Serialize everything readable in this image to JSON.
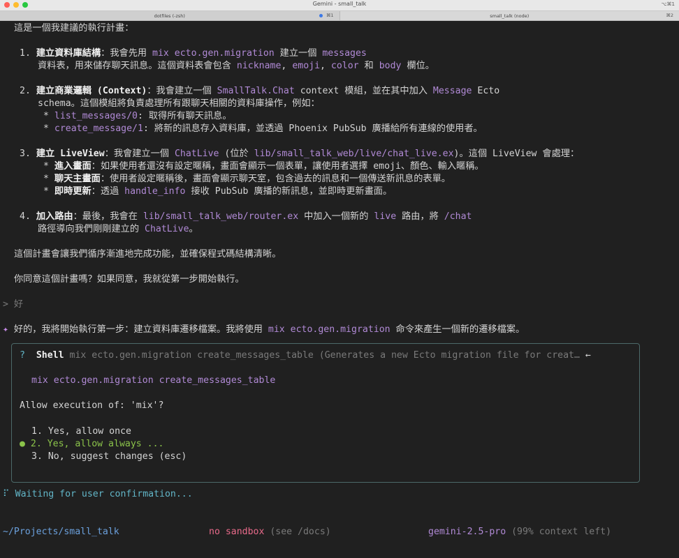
{
  "window": {
    "title": "Gemini - small_talk",
    "shortcut": "⌥⌘1"
  },
  "tabs": [
    {
      "label": "dotfiles (-zsh)",
      "kbd": "⌘1"
    },
    {
      "label": "small_talk (node)",
      "kbd": "⌘2"
    }
  ],
  "plan": {
    "intro": "這是一個我建議的執行計畫：",
    "s1_num": "1.",
    "s1_title": "建立資料庫結構",
    "s1_a": "：我會先用 ",
    "s1_cmd": "mix ecto.gen.migration",
    "s1_b": " 建立一個 ",
    "s1_tbl": "messages",
    "s1_c": "資料表，用來儲存聊天訊息。這個資料表會包含 ",
    "f1": "nickname",
    "sep1": ", ",
    "f2": "emoji",
    "sep2": ", ",
    "f3": "color",
    "s1_and": " 和 ",
    "f4": "body",
    "s1_end": " 欄位。",
    "s2_num": "2.",
    "s2_title": "建立商業邏輯 (Context)",
    "s2_a": "：我會建立一個 ",
    "s2_ctx": "SmallTalk.Chat",
    "s2_b": " context 模組，並在其中加入 ",
    "s2_msg": "Message",
    "s2_c": " Ecto",
    "s2_d": "schema。這個模組將負責處理所有跟聊天相關的資料庫操作，例如：",
    "s2_f1": "list_messages/0",
    "s2_f1d": ": 取得所有聊天訊息。",
    "s2_f2": "create_message/1",
    "s2_f2d": ": 將新的訊息存入資料庫，並透過 Phoenix PubSub 廣播給所有連線的使用者。",
    "s3_num": "3.",
    "s3_title": "建立 LiveView",
    "s3_a": "：我會建立一個 ",
    "s3_live": "ChatLive",
    "s3_b": " (位於 ",
    "s3_path": "lib/small_talk_web/live/chat_live.ex",
    "s3_c": ")。這個 LiveView 會處理：",
    "s3_i1t": "進入畫面",
    "s3_i1": "：如果使用者還沒有設定暱稱，畫面會顯示一個表單，讓使用者選擇 emoji、顏色、輸入暱稱。",
    "s3_i2t": "聊天主畫面",
    "s3_i2": "：使用者設定暱稱後，畫面會顯示聊天室，包含過去的訊息和一個傳送新訊息的表單。",
    "s3_i3t": "即時更新",
    "s3_i3a": "：透過 ",
    "s3_hi": "handle_info",
    "s3_i3b": " 接收 PubSub 廣播的新訊息，並即時更新畫面。",
    "s4_num": "4.",
    "s4_title": "加入路由",
    "s4_a": "：最後，我會在 ",
    "s4_path": "lib/small_talk_web/router.ex",
    "s4_b": " 中加入一個新的 ",
    "s4_live": "live",
    "s4_c": " 路由，將 ",
    "s4_chat": "/chat",
    "s4_d": "路徑導向我們剛剛建立的 ",
    "s4_cl": "ChatLive",
    "s4_e": "。",
    "outro1": "這個計畫會讓我們循序漸進地完成功能，並確保程式碼結構清晰。",
    "outro2": "你同意這個計畫嗎？如果同意，我就從第一步開始執行。"
  },
  "user": {
    "prompt": ">",
    "reply": "好"
  },
  "reply": {
    "icon": "✦",
    "a": "好的，我將開始執行第一步：建立資料庫遷移檔案。我將使用 ",
    "cmd": "mix ecto.gen.migration",
    "b": " 命令來產生一個新的遷移檔案。"
  },
  "confirm": {
    "q": "?",
    "tool": "Shell",
    "desc": "mix ecto.gen.migration create_messages_table (Generates a new Ecto migration file for creat…",
    "arrow": "←",
    "command": "mix ecto.gen.migration create_messages_table",
    "prompt": "Allow execution of: 'mix'?",
    "options": [
      "1. Yes, allow once",
      "2. Yes, allow always ...",
      "3. No, suggest changes (esc)"
    ],
    "selected_marker": "●"
  },
  "waiting": {
    "icon": "⠏",
    "text": "Waiting for user confirmation..."
  },
  "footer": {
    "path": "~/Projects/small_talk",
    "sandbox": "no sandbox",
    "docs": "(see /docs)",
    "model": "gemini-2.5-pro",
    "context": "(99% context left)"
  },
  "colors": {
    "accent": "#b18ad6",
    "green": "#8bc34a",
    "cyan": "#62b6c8",
    "pink": "#e86a8a",
    "border": "#4c6a6a"
  }
}
